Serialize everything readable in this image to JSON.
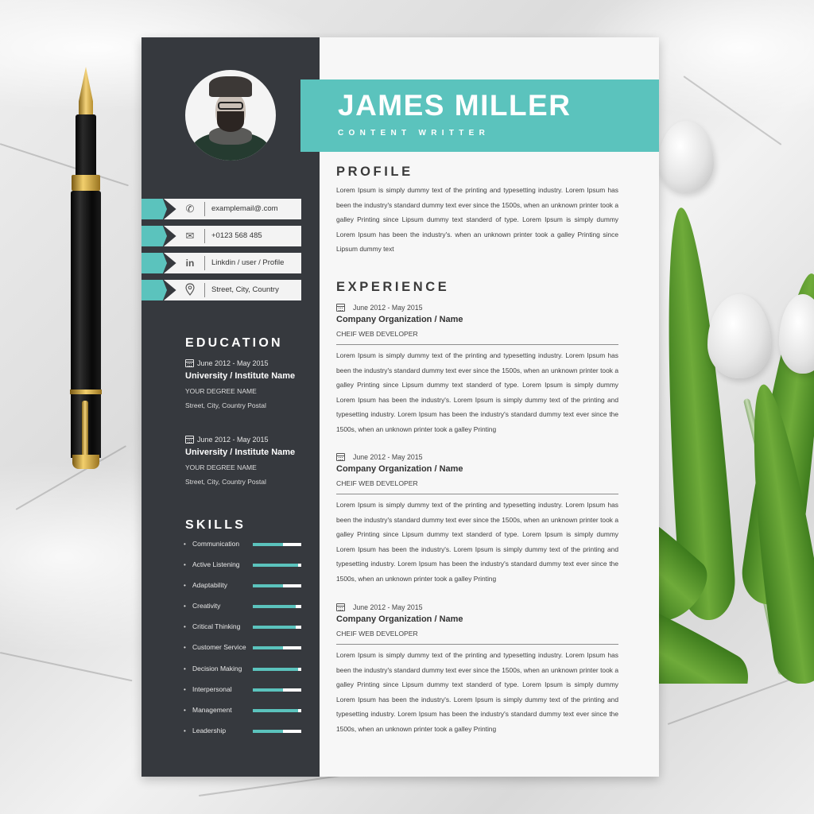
{
  "resume": {
    "name": "JAMES MILLER",
    "job_title": "CONTENT WRITTER",
    "accent_color": "#5bc3bd",
    "sidebar_color": "#36393e",
    "contacts": [
      {
        "icon": "phone-icon",
        "text": "examplemail@.com"
      },
      {
        "icon": "envelope-icon",
        "text": "+0123 568 485"
      },
      {
        "icon": "linkedin-icon",
        "text": "Linkdin / user / Profile"
      },
      {
        "icon": "location-pin-icon",
        "text": "Street, City, Country"
      }
    ],
    "education": {
      "heading": "EDUCATION",
      "items": [
        {
          "date": "June 2012 - May 2015",
          "school": "University / Institute Name",
          "degree": "YOUR DEGREE NAME",
          "address": "Street, City, Country Postal"
        },
        {
          "date": "June 2012 - May 2015",
          "school": "University / Institute Name",
          "degree": "YOUR DEGREE NAME",
          "address": "Street, City, Country Postal"
        }
      ]
    },
    "skills": {
      "heading": "SKILLS",
      "items": [
        {
          "name": "Communication",
          "level": 0.63
        },
        {
          "name": "Active Listening",
          "level": 0.93
        },
        {
          "name": "Adaptability",
          "level": 0.63
        },
        {
          "name": "Creativity",
          "level": 0.89
        },
        {
          "name": "Critical Thinking",
          "level": 0.89
        },
        {
          "name": "Customer Service",
          "level": 0.63
        },
        {
          "name": "Decision Making",
          "level": 0.93
        },
        {
          "name": "Interpersonal",
          "level": 0.63
        },
        {
          "name": "Management",
          "level": 0.93
        },
        {
          "name": "Leadership",
          "level": 0.63
        }
      ]
    },
    "profile": {
      "heading": "PROFILE",
      "text": "Lorem Ipsum is simply dummy text of the printing and typesetting industry. Lorem Ipsum has been the industry's standard dummy text ever since the 1500s, when an unknown printer took a galley Printing since Lipsum dummy text standerd of type. Lorem Ipsum is simply dummy Lorem Ipsum has been the industry's. when an unknown printer took a galley Printing since Lipsum dummy text"
    },
    "experience": {
      "heading": "EXPERIENCE",
      "items": [
        {
          "date": "June 2012 - May 2015",
          "company": "Company  Organization / Name",
          "role": "CHEIF WEB DEVELOPER",
          "text": "Lorem Ipsum is simply dummy text of the printing and typesetting industry. Lorem Ipsum has been the industry's standard dummy text ever since the 1500s, when an unknown printer took a galley Printing since Lipsum dummy text standerd of type. Lorem Ipsum is simply dummy Lorem Ipsum has been the industry's. Lorem Ipsum is simply dummy text of the printing and typesetting industry. Lorem Ipsum has been the industry's standard dummy text ever since the 1500s, when an unknown printer took a galley Printing"
        },
        {
          "date": "June 2012 - May 2015",
          "company": "Company  Organization / Name",
          "role": "CHEIF WEB DEVELOPER",
          "text": "Lorem Ipsum is simply dummy text of the printing and typesetting industry. Lorem Ipsum has been the industry's standard dummy text ever since the 1500s, when an unknown printer took a galley Printing since Lipsum dummy text standerd of type. Lorem Ipsum is simply dummy Lorem Ipsum has been the industry's. Lorem Ipsum is simply dummy text of the printing and typesetting industry. Lorem Ipsum has been the industry's standard dummy text ever since the 1500s, when an unknown printer took a galley Printing"
        },
        {
          "date": "June 2012 - May 2015",
          "company": "Company  Organization / Name",
          "role": "CHEIF WEB DEVELOPER",
          "text": "Lorem Ipsum is simply dummy text of the printing and typesetting industry. Lorem Ipsum has been the industry's standard dummy text ever since the 1500s, when an unknown printer took a galley Printing since Lipsum dummy text standerd of type. Lorem Ipsum is simply dummy Lorem Ipsum has been the industry's. Lorem Ipsum is simply dummy text of the printing and typesetting industry. Lorem Ipsum has been the industry's standard dummy text ever since the 1500s, when an unknown printer took a galley Printing"
        }
      ]
    }
  }
}
